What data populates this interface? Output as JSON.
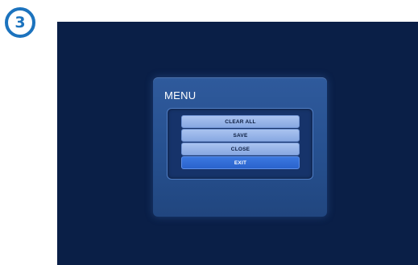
{
  "step_badge": {
    "number": "3"
  },
  "menu": {
    "title": "MENU",
    "items": [
      {
        "label": "CLEAR ALL",
        "selected": false
      },
      {
        "label": "SAVE",
        "selected": false
      },
      {
        "label": "CLOSE",
        "selected": false
      },
      {
        "label": "EXIT",
        "selected": true
      }
    ]
  },
  "colors": {
    "screen_background": "#0a1f47",
    "menu_window": "#2f5a9c",
    "menu_item": "#a9c3f0",
    "menu_item_selected": "#2a63cc",
    "badge_accent": "#1c73be"
  }
}
